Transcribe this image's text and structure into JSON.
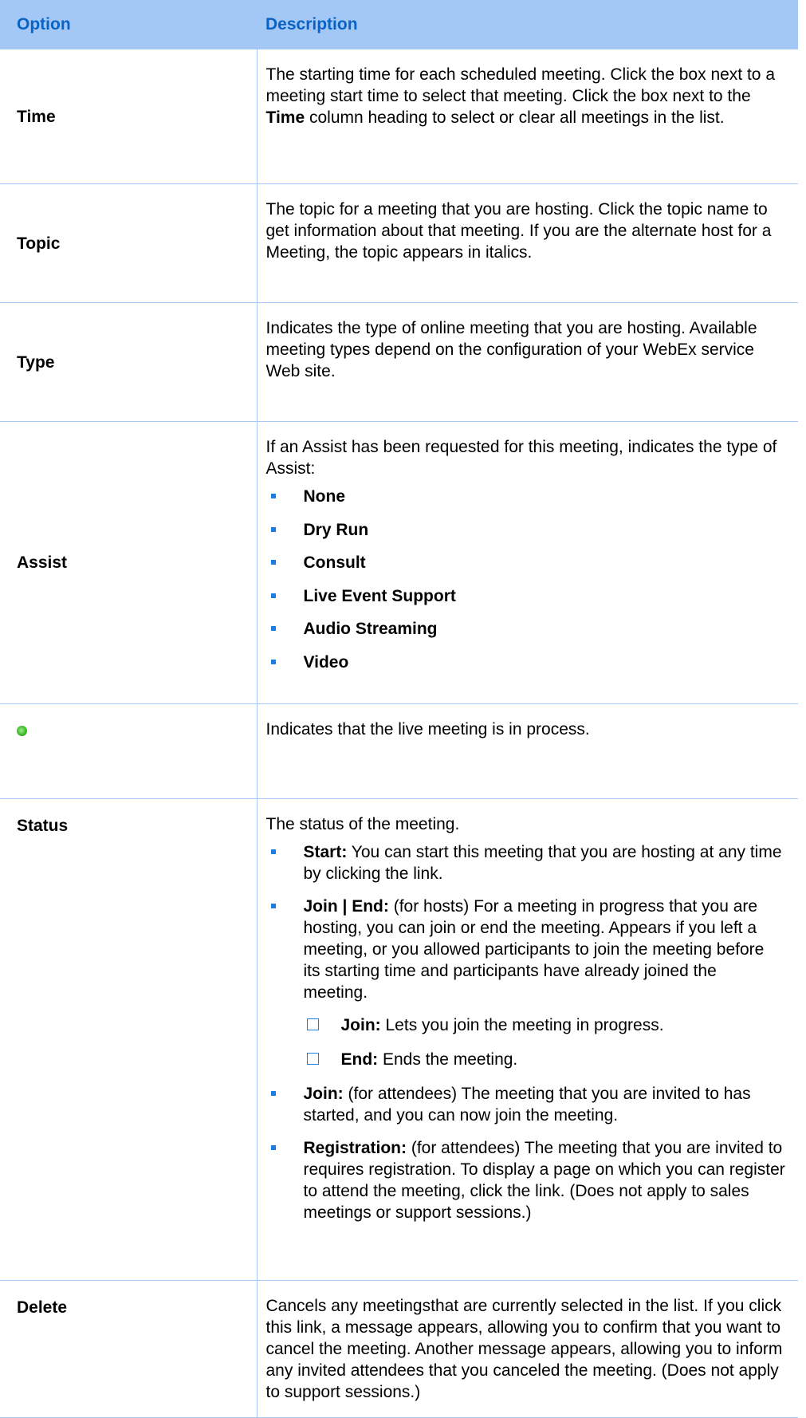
{
  "header": {
    "option": "Option",
    "description": "Description"
  },
  "rows": {
    "time": {
      "option": "Time",
      "desc_a": "The starting time for each scheduled meeting. Click the box next to a meeting start time to select that meeting. Click the box next to the ",
      "desc_bold": "Time",
      "desc_b": " column heading to select or clear all meetings in the list."
    },
    "topic": {
      "option": "Topic",
      "desc": "The topic for a meeting that you are hosting. Click the topic name to get information about that meeting. If you are the alternate host for a Meeting, the topic appears in italics."
    },
    "type": {
      "option": "Type",
      "desc": "Indicates the type of online meeting that you are hosting. Available meeting types depend on the configuration of your WebEx service Web site."
    },
    "assist": {
      "option": "Assist",
      "desc": "If an Assist has been requested for this meeting, indicates the type of Assist:",
      "items": [
        "None",
        "Dry Run",
        "Consult",
        "Live Event Support",
        "Audio Streaming",
        "Video"
      ]
    },
    "live": {
      "icon": "green-status-dot-icon",
      "desc": "Indicates that the live meeting is in process."
    },
    "status": {
      "option": "Status",
      "desc": "The status of the meeting.",
      "items": [
        {
          "term": "Start:",
          "text": " You can start this meeting that you are hosting at any time by clicking the link."
        },
        {
          "term": "Join | End:",
          "text": " (for hosts) For a meeting in progress that you are hosting, you can join or end the meeting. Appears if you left a meeting, or you allowed participants to join the meeting before its starting time and participants have already joined the meeting."
        },
        {
          "term": "Join:",
          "text": " (for attendees) The meeting that you are invited to has started, and you can now join the meeting."
        },
        {
          "term": "Registration:",
          "text": " (for attendees) The meeting that you are invited to requires registration. To display a page on which you can register to attend the meeting, click the link. (Does not apply to sales meetings or support sessions.)"
        }
      ],
      "subitems": [
        {
          "term": "Join:",
          "text": " Lets you join the meeting in progress."
        },
        {
          "term": "End:",
          "text": " Ends the meeting."
        }
      ]
    },
    "delete": {
      "option": "Delete",
      "desc": "Cancels any meetingsthat are currently selected in the list. If you click this link, a message appears, allowing you to confirm that you want to cancel the meeting. Another message appears, allowing you to inform any invited attendees that you canceled the meeting. (Does not apply to support sessions.)"
    }
  }
}
